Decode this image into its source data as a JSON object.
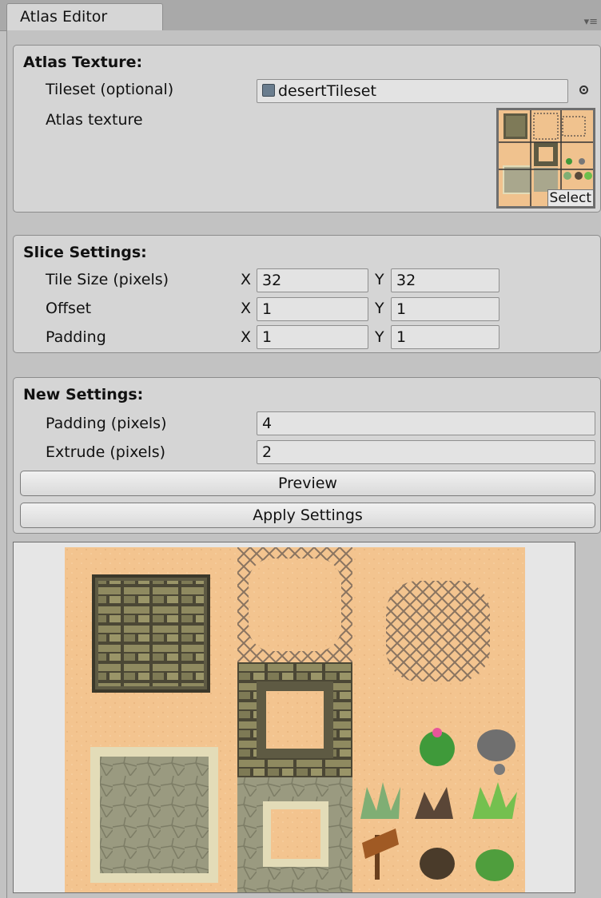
{
  "window": {
    "tab_title": "Atlas Editor"
  },
  "atlas_texture": {
    "title": "Atlas Texture:",
    "tileset_label": "Tileset (optional)",
    "tileset_value": "desertTileset",
    "atlas_label": "Atlas texture",
    "select_label": "Select"
  },
  "slice_settings": {
    "title": "Slice Settings:",
    "rows": [
      {
        "label": "Tile Size (pixels)",
        "x": "32",
        "y": "32"
      },
      {
        "label": "Offset",
        "x": "1",
        "y": "1"
      },
      {
        "label": "Padding",
        "x": "1",
        "y": "1"
      }
    ],
    "x_axis": "X",
    "y_axis": "Y"
  },
  "new_settings": {
    "title": "New Settings:",
    "padding_label": "Padding (pixels)",
    "padding_value": "4",
    "extrude_label": "Extrude (pixels)",
    "extrude_value": "2",
    "preview_button": "Preview",
    "apply_button": "Apply Settings"
  },
  "colors": {
    "sand": "#f3c48f",
    "stone_dark": "#5e5a43",
    "stone_light": "#e3dcb8",
    "paving": "#a9a78d",
    "cactus": "#3f9a3a",
    "blossom": "#e8559a"
  }
}
